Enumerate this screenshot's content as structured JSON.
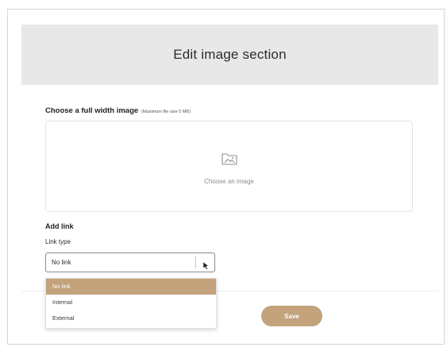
{
  "modal": {
    "title": "Edit image section",
    "close_label": "×"
  },
  "image": {
    "label": "Choose a full width image",
    "hint": "(Maximum file size 5 MB)",
    "dropzone_text": "Choose an image",
    "icon": "image-folder-icon"
  },
  "link": {
    "section_label": "Add link",
    "type_label": "Link type",
    "selected_value": "No link",
    "options": [
      "No link",
      "Internal",
      "External"
    ]
  },
  "footer": {
    "save_label": "Save"
  },
  "colors": {
    "accent": "#c3a27c",
    "header_bg": "#e8e8e8"
  }
}
